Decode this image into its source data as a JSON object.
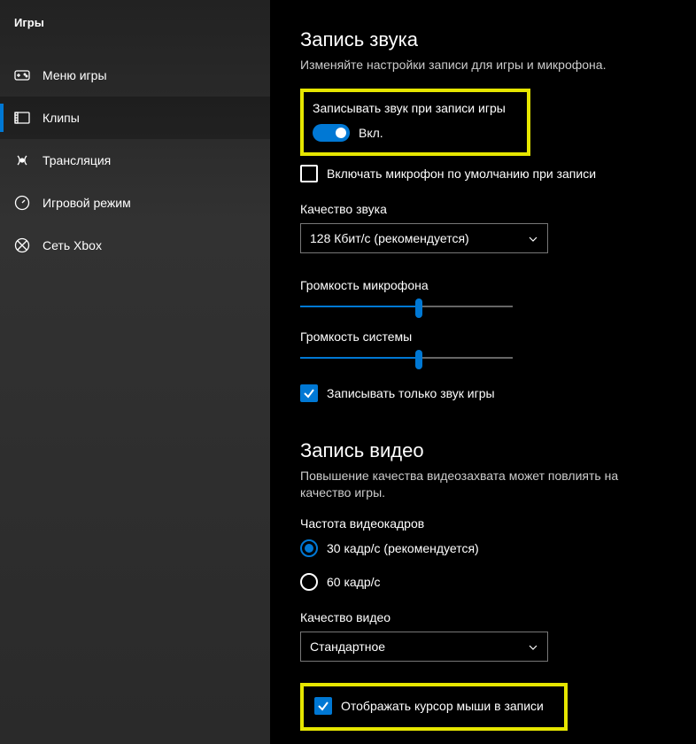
{
  "sidebar": {
    "title": "Игры",
    "items": [
      {
        "label": "Меню игры"
      },
      {
        "label": "Клипы"
      },
      {
        "label": "Трансляция"
      },
      {
        "label": "Игровой режим"
      },
      {
        "label": "Сеть Xbox"
      }
    ]
  },
  "audio": {
    "section_title": "Запись звука",
    "section_desc": "Изменяйте настройки записи для игры и микрофона.",
    "record_audio_label": "Записывать звук при записи игры",
    "toggle_state": "Вкл.",
    "mic_default_label": "Включать микрофон по умолчанию при записи",
    "quality_label": "Качество звука",
    "quality_value": "128 Кбит/с (рекомендуется)",
    "mic_volume_label": "Громкость микрофона",
    "sys_volume_label": "Громкость системы",
    "only_game_label": "Записывать только звук игры"
  },
  "video": {
    "section_title": "Запись видео",
    "section_desc": "Повышение качества видеозахвата может повлиять на качество игры.",
    "fps_label": "Частота видеокадров",
    "fps_options": [
      {
        "label": "30 кадр/с (рекомендуется)"
      },
      {
        "label": "60 кадр/с"
      }
    ],
    "quality_label": "Качество видео",
    "quality_value": "Стандартное",
    "cursor_label": "Отображать курсор мыши в записи"
  }
}
